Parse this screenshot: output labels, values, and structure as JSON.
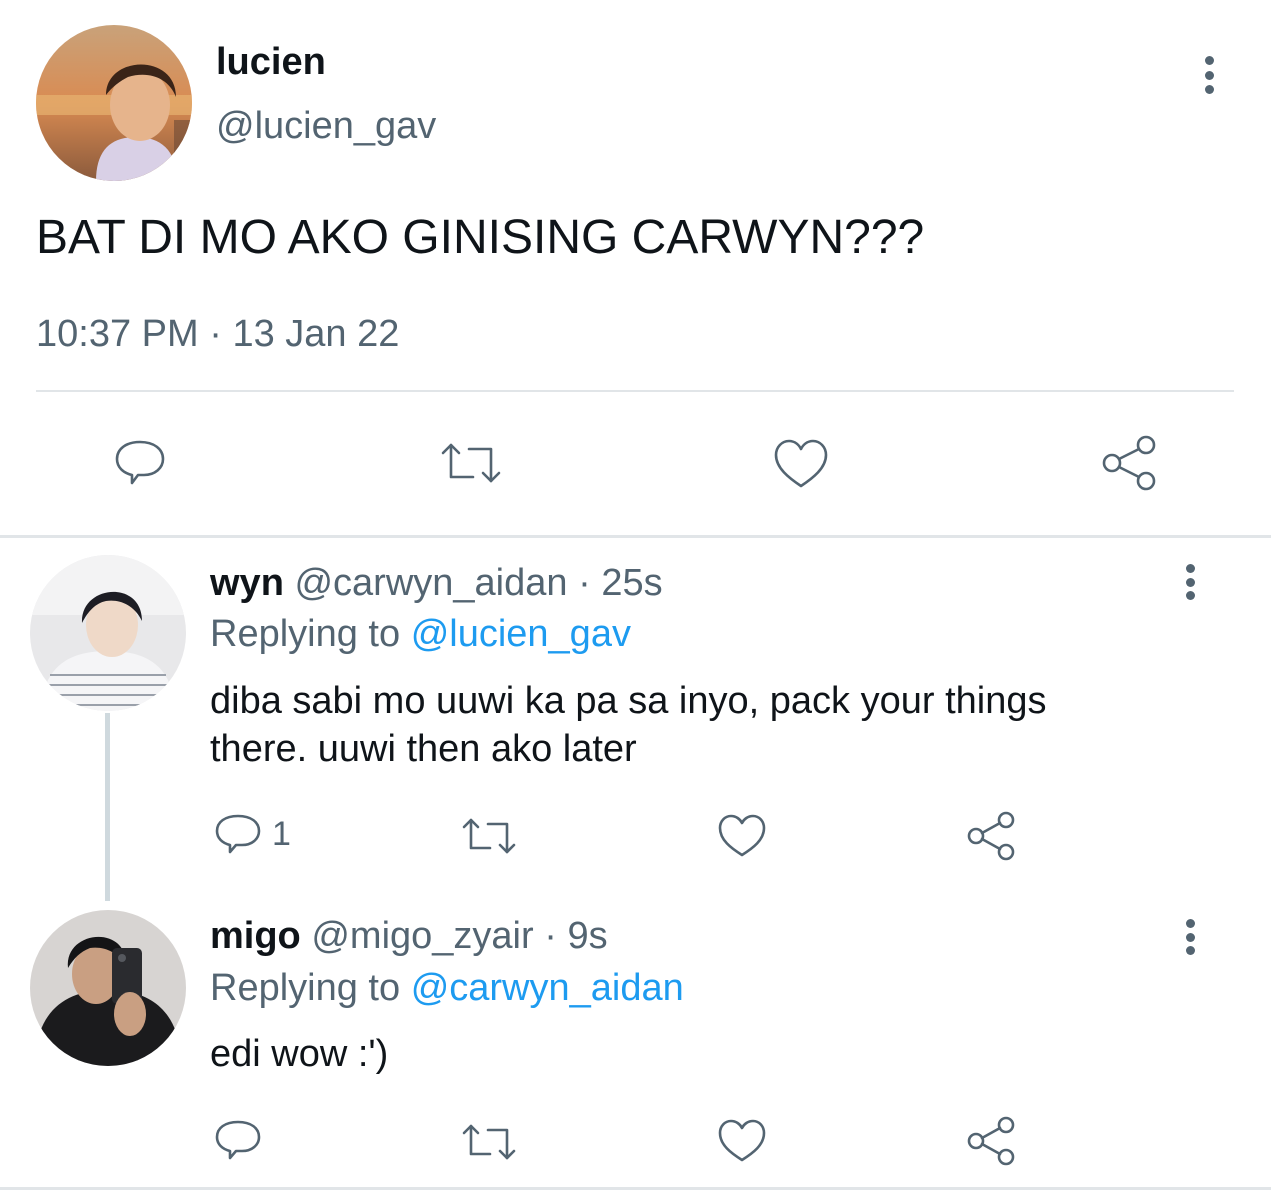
{
  "main_tweet": {
    "display_name": "lucien",
    "handle": "@lucien_gav",
    "text": "BAT DI MO AKO GINISING CARWYN???",
    "time": "10:37 PM",
    "date_sep": "·",
    "date": "13 Jan 22",
    "icons": [
      "reply-icon",
      "retweet-icon",
      "like-icon",
      "share-icon"
    ]
  },
  "replies": [
    {
      "display_name": "wyn",
      "handle": "@carwyn_aidan",
      "sep": "·",
      "age": "25s",
      "replying_prefix": "Replying to",
      "replying_to": "@lucien_gav",
      "text_line1": "diba sabi mo uuwi ka pa sa inyo, pack your things",
      "text_line2": "there. uuwi then ako later",
      "reply_count": "1"
    },
    {
      "display_name": "migo",
      "handle": "@migo_zyair",
      "sep": "·",
      "age": "9s",
      "replying_prefix": "Replying to",
      "replying_to": "@carwyn_aidan",
      "text_line1": "edi wow :')",
      "reply_count": ""
    }
  ],
  "colors": {
    "text": "#0f1419",
    "muted": "#536471",
    "link": "#1d9bf0",
    "divider": "#e1e5e8"
  }
}
